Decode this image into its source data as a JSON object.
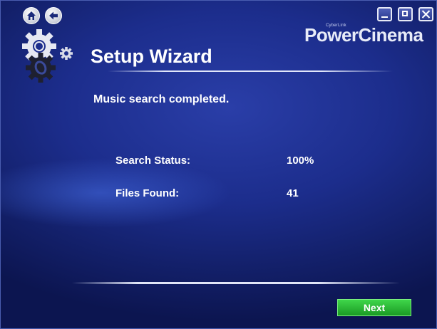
{
  "window": {
    "brand_small": "CyberLink",
    "brand": "PowerCinema",
    "controls": [
      "minimize-icon",
      "maximize-icon",
      "close-icon"
    ]
  },
  "nav": {
    "home_icon": "home-icon",
    "back_icon": "back-arrow-icon"
  },
  "header": {
    "title": "Setup Wizard",
    "icon": "gears-icon"
  },
  "main": {
    "message": "Music search completed.",
    "rows": [
      {
        "label": "Search Status:",
        "value": "100%"
      },
      {
        "label": "Files Found:",
        "value": "41"
      }
    ]
  },
  "footer": {
    "next_label": "Next"
  },
  "colors": {
    "background": "#1c2d8c",
    "next_button": "#2fbf3a",
    "text": "#ffffff"
  }
}
